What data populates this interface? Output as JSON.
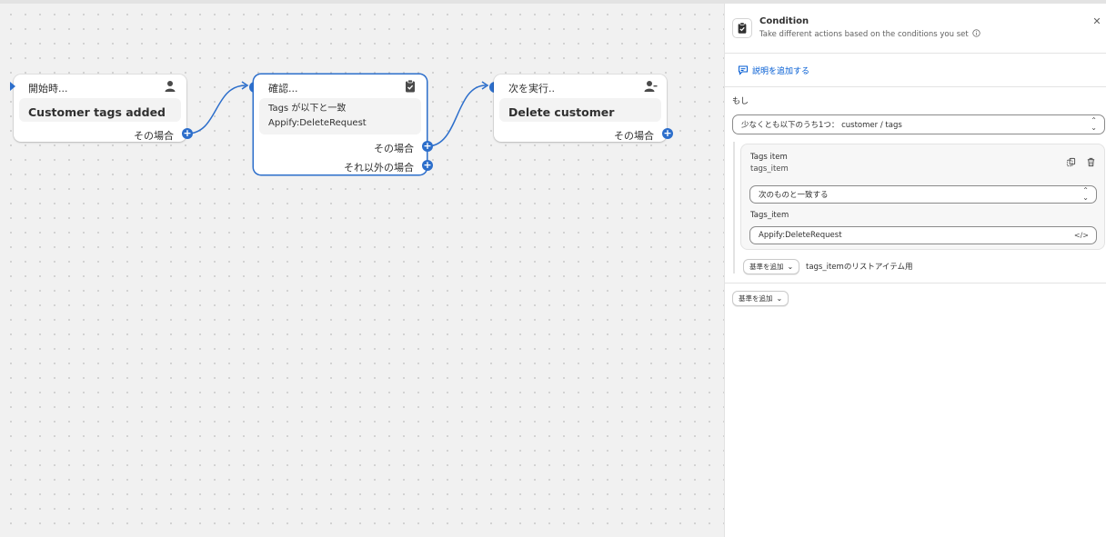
{
  "nodes": {
    "trigger": {
      "header": "開始時...",
      "title": "Customer tags added",
      "port": "その場合"
    },
    "condition": {
      "header": "確認...",
      "cond_line1": "Tags が以下と一致",
      "cond_line2": "Appify:DeleteRequest",
      "port_true": "その場合",
      "port_false": "それ以外の場合"
    },
    "action": {
      "header": "次を実行..",
      "title": "Delete customer",
      "port": "その場合"
    }
  },
  "panel": {
    "title": "Condition",
    "subtitle": "Take different actions based on the conditions you set",
    "add_description": "説明を追加する",
    "if_label": "もし",
    "group_select": "少なくとも以下のうち1つ： customer / tags",
    "item": {
      "title": "Tags item",
      "subtitle": "tags_item",
      "operator": "次のものと一致する",
      "field_label": "Tags_item",
      "value": "Appify:DeleteRequest"
    },
    "add_criteria_inner": "基準を追加",
    "add_criteria_note": "tags_itemのリストアイテム用",
    "add_criteria_outer": "基準を追加"
  },
  "colors": {
    "accent": "#2c6ecb",
    "link": "#005bd3"
  },
  "icons": {
    "trigger": "person-icon",
    "condition": "clipboard-check-icon",
    "action": "person-remove-icon",
    "info": "info-icon",
    "duplicate": "duplicate-icon",
    "delete": "trash-icon",
    "code": "code-icon",
    "close": "close-icon"
  }
}
